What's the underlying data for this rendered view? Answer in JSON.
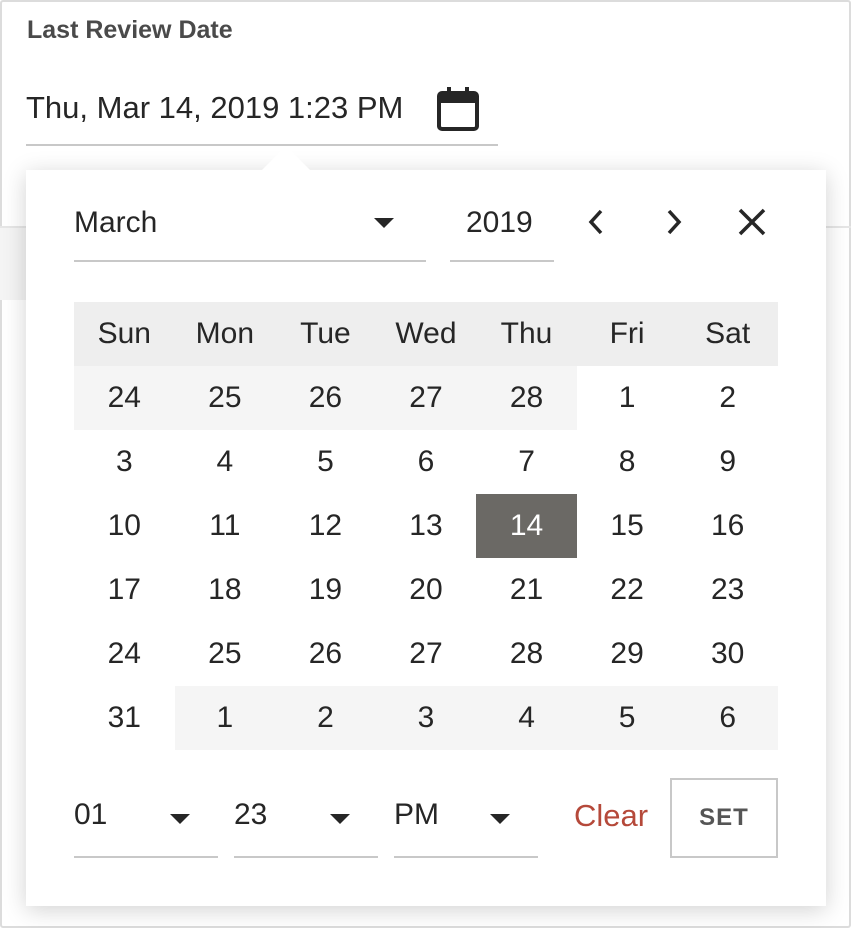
{
  "field": {
    "label": "Last Review Date",
    "value": "Thu, Mar 14, 2019 1:23 PM",
    "icon": "calendar-icon"
  },
  "picker": {
    "month": "March",
    "year": "2019",
    "weekdays": [
      "Sun",
      "Mon",
      "Tue",
      "Wed",
      "Thu",
      "Fri",
      "Sat"
    ],
    "weeks": [
      [
        {
          "d": "24",
          "other": true
        },
        {
          "d": "25",
          "other": true
        },
        {
          "d": "26",
          "other": true
        },
        {
          "d": "27",
          "other": true
        },
        {
          "d": "28",
          "other": true
        },
        {
          "d": "1"
        },
        {
          "d": "2"
        }
      ],
      [
        {
          "d": "3"
        },
        {
          "d": "4"
        },
        {
          "d": "5"
        },
        {
          "d": "6"
        },
        {
          "d": "7"
        },
        {
          "d": "8"
        },
        {
          "d": "9"
        }
      ],
      [
        {
          "d": "10"
        },
        {
          "d": "11"
        },
        {
          "d": "12"
        },
        {
          "d": "13"
        },
        {
          "d": "14",
          "selected": true
        },
        {
          "d": "15"
        },
        {
          "d": "16"
        }
      ],
      [
        {
          "d": "17"
        },
        {
          "d": "18"
        },
        {
          "d": "19"
        },
        {
          "d": "20"
        },
        {
          "d": "21"
        },
        {
          "d": "22"
        },
        {
          "d": "23"
        }
      ],
      [
        {
          "d": "24"
        },
        {
          "d": "25"
        },
        {
          "d": "26"
        },
        {
          "d": "27"
        },
        {
          "d": "28"
        },
        {
          "d": "29"
        },
        {
          "d": "30"
        }
      ],
      [
        {
          "d": "31"
        },
        {
          "d": "1",
          "other": true
        },
        {
          "d": "2",
          "other": true
        },
        {
          "d": "3",
          "other": true
        },
        {
          "d": "4",
          "other": true
        },
        {
          "d": "5",
          "other": true
        },
        {
          "d": "6",
          "other": true
        }
      ]
    ],
    "hour": "01",
    "minute": "23",
    "ampm": "PM",
    "clear_label": "Clear",
    "set_label": "SET"
  },
  "colors": {
    "selected_bg": "#6b6965",
    "clear_text": "#b5493a",
    "other_month_bg": "#f5f5f5",
    "header_bg": "#eeeeee"
  }
}
